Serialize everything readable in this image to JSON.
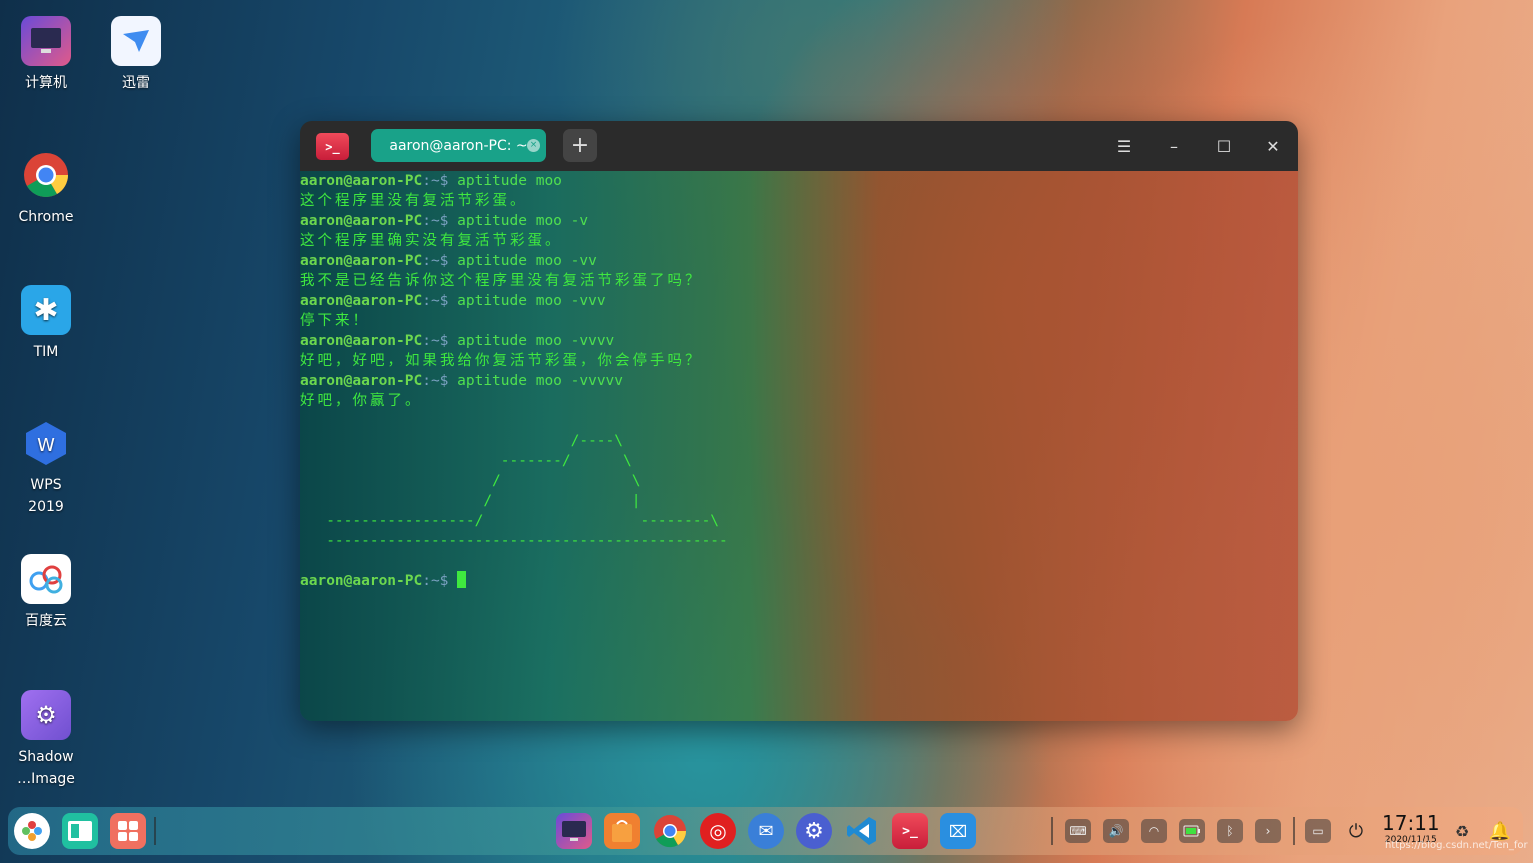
{
  "desktop": {
    "icons": [
      {
        "label": "计算机"
      },
      {
        "label": "迅雷"
      },
      {
        "label": "Chrome"
      },
      {
        "label": "TIM"
      },
      {
        "label": "WPS"
      },
      {
        "label": "2019"
      },
      {
        "label": "百度云"
      },
      {
        "label": "Shadow"
      },
      {
        "label": "…Image"
      }
    ]
  },
  "terminal": {
    "tab_title": "aaron@aaron-PC: ~",
    "tab_close": "×",
    "new_tab": "+",
    "menu": "☰",
    "minimize": "–",
    "maximize": "☐",
    "close": "✕",
    "prompt_user": "aaron@aaron-PC",
    "prompt_path": ":~$ ",
    "lines": [
      {
        "cmd": "aptitude moo"
      },
      {
        "out": "这个程序里没有复活节彩蛋。"
      },
      {
        "cmd": "aptitude moo -v"
      },
      {
        "out": "这个程序里确实没有复活节彩蛋。"
      },
      {
        "cmd": "aptitude moo -vv"
      },
      {
        "out": "我不是已经告诉你这个程序里没有复活节彩蛋了吗？"
      },
      {
        "cmd": "aptitude moo -vvv"
      },
      {
        "out": "停下来！"
      },
      {
        "cmd": "aptitude moo -vvvv"
      },
      {
        "out": "好吧，好吧，如果我给你复活节彩蛋，你会停手吗？"
      },
      {
        "cmd": "aptitude moo -vvvvv"
      },
      {
        "out": "好吧，你赢了。"
      }
    ],
    "art": [
      "",
      "                               /----\\",
      "                       -------/      \\",
      "                      /               \\",
      "                     /                |",
      "   -----------------/                  --------\\",
      "   ----------------------------------------------"
    ],
    "final_prompt": ""
  },
  "dock": {
    "clock_time": "17:11",
    "clock_date": "2020/11/15",
    "watermark": "https://blog.csdn.net/Ten_for"
  },
  "colors": {
    "accent": "#19a289",
    "prompt": "#6cd84e",
    "output": "#3fe83f"
  }
}
